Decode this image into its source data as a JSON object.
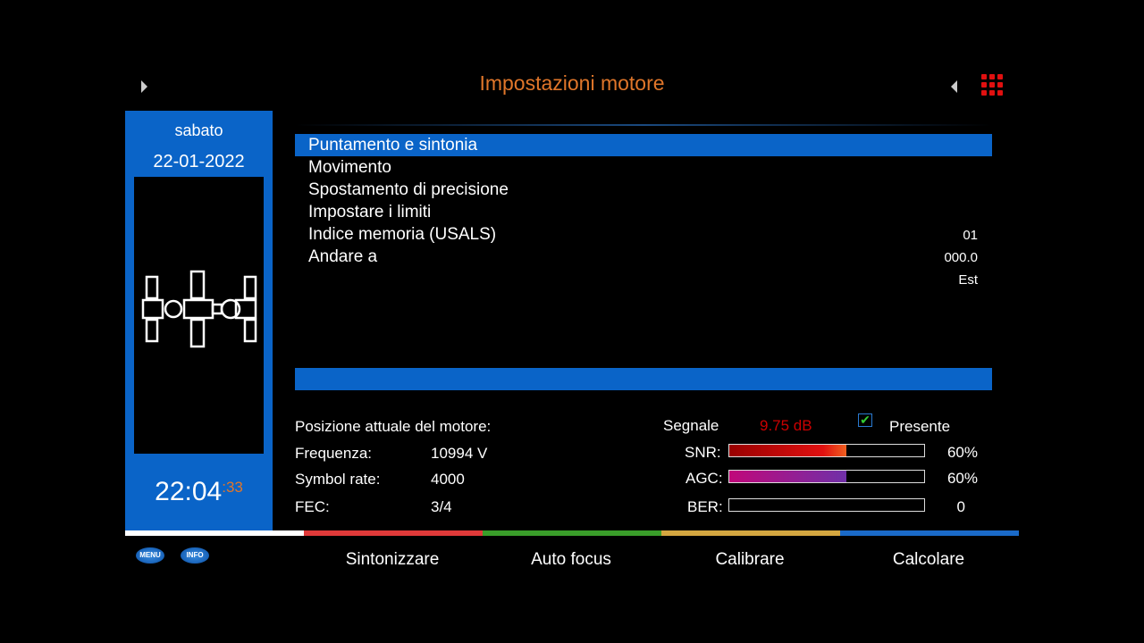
{
  "header": {
    "title": "Impostazioni motore"
  },
  "sidebar": {
    "day": "sabato",
    "date": "22-01-2022",
    "time": "22:04",
    "seconds": ":33"
  },
  "menu": [
    {
      "label": "Puntamento e sintonia",
      "value": ""
    },
    {
      "label": "Movimento",
      "value": ""
    },
    {
      "label": "Spostamento di precisione",
      "value": ""
    },
    {
      "label": "Impostare i limiti",
      "value": ""
    },
    {
      "label": "Indice memoria (USALS)",
      "value": "01"
    },
    {
      "label": "Andare a",
      "value": "000.0"
    }
  ],
  "extra_value": "Est",
  "info": {
    "position_label": "Posizione attuale del motore:",
    "freq_label": "Frequenza:",
    "freq": "10994 V",
    "sr_label": "Symbol rate:",
    "sr": "4000",
    "fec_label": "FEC:",
    "fec": "3/4"
  },
  "signal": {
    "label": "Segnale",
    "db": "9.75 dB",
    "present": "Presente",
    "snr_label": "SNR:",
    "snr": "60%",
    "snr_frac": 0.6,
    "agc_label": "AGC:",
    "agc": "60%",
    "agc_frac": 0.6,
    "ber_label": "BER:",
    "ber": "0",
    "ber_frac": 0
  },
  "footer": {
    "menu": "MENU",
    "info": "INFO",
    "buttons": [
      "Sintonizzare",
      "Auto focus",
      "Calibrare",
      "Calcolare"
    ],
    "colors": [
      "#ffffff",
      "#e03a3a",
      "#3a9e2a",
      "#d4a640",
      "#1a6ac8"
    ]
  }
}
